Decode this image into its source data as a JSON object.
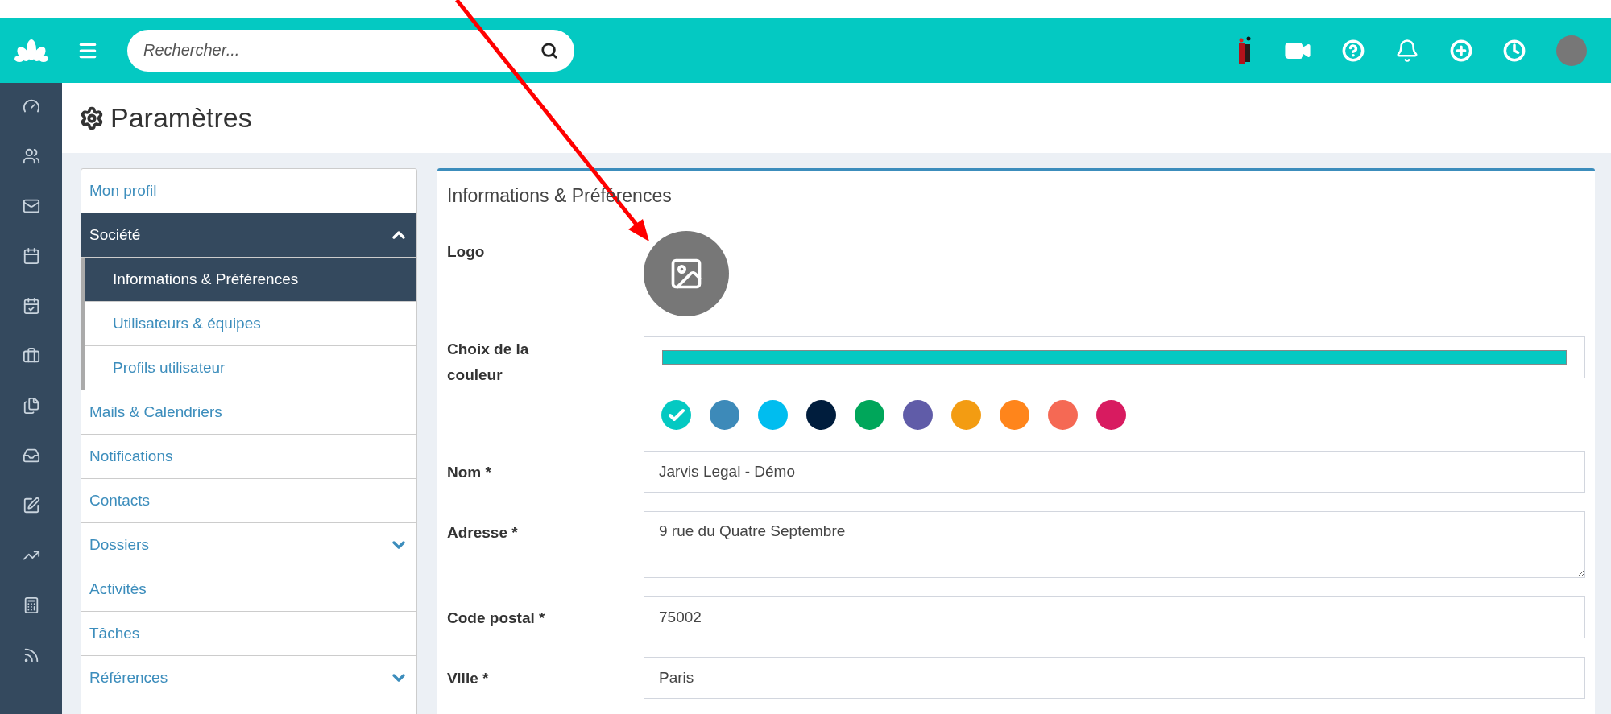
{
  "topbar": {
    "search": {
      "placeholder": "Rechercher..."
    }
  },
  "page": {
    "title": "Paramètres"
  },
  "settings_menu": [
    {
      "label": "Mon profil",
      "selected": false,
      "expanded": false
    },
    {
      "label": "Société",
      "selected": true,
      "expanded": true,
      "children": [
        {
          "label": "Informations & Préférences",
          "selected": true
        },
        {
          "label": "Utilisateurs & équipes",
          "selected": false
        },
        {
          "label": "Profils utilisateur",
          "selected": false
        }
      ]
    },
    {
      "label": "Mails & Calendriers",
      "selected": false,
      "expanded": false
    },
    {
      "label": "Notifications",
      "selected": false,
      "expanded": false
    },
    {
      "label": "Contacts",
      "selected": false,
      "expanded": false
    },
    {
      "label": "Dossiers",
      "selected": false,
      "expanded": false,
      "kind": "group"
    },
    {
      "label": "Activités",
      "selected": false,
      "expanded": false
    },
    {
      "label": "Tâches",
      "selected": false,
      "expanded": false
    },
    {
      "label": "Références",
      "selected": false,
      "expanded": false,
      "kind": "group"
    }
  ],
  "panel": {
    "title": "Informations & Préférences",
    "logo_label": "Logo",
    "color_label": "Choix de la couleur",
    "colors": [
      {
        "color": "#04c9c2",
        "selected": true
      },
      {
        "color": "#3d8ab9",
        "selected": false
      },
      {
        "color": "#00bdef",
        "selected": false
      },
      {
        "color": "#001d3d",
        "selected": false
      },
      {
        "color": "#00a65a",
        "selected": false
      },
      {
        "color": "#605ca8",
        "selected": false
      },
      {
        "color": "#f39c12",
        "selected": false
      },
      {
        "color": "#ff851b",
        "selected": false
      },
      {
        "color": "#f56954",
        "selected": false
      },
      {
        "color": "#d81b60",
        "selected": false
      }
    ],
    "fields": [
      {
        "label": "Nom *",
        "value": "Jarvis Legal - Démo",
        "kind": "input"
      },
      {
        "label": "Adresse *",
        "value": "9 rue du Quatre Septembre",
        "kind": "textarea"
      },
      {
        "label": "Code postal *",
        "value": "75002",
        "kind": "input"
      },
      {
        "label": "Ville *",
        "value": "Paris",
        "kind": "input"
      }
    ]
  }
}
